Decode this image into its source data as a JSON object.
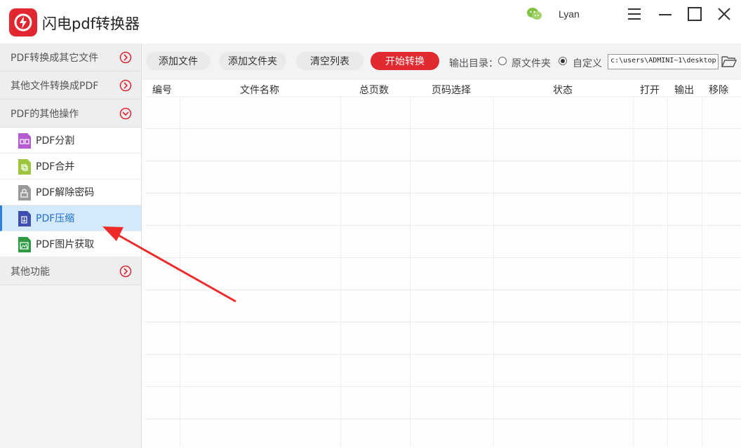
{
  "app": {
    "title": "闪电pdf转换器",
    "user_name": "Lyan",
    "accent_color": "#e0272f",
    "icons": [
      "logo-icon",
      "wechat-icon",
      "menu-icon",
      "minimize-icon",
      "maximize-icon",
      "close-icon"
    ]
  },
  "sidebar": {
    "categories": [
      {
        "label": "PDF转换成其它文件",
        "state": "collapsed"
      },
      {
        "label": "其他文件转换成PDF",
        "state": "collapsed"
      },
      {
        "label": "PDF的其他操作",
        "state": "expanded"
      },
      {
        "label": "其他功能",
        "state": "collapsed"
      }
    ],
    "items": [
      {
        "label": "PDF分割",
        "icon": "split-file-icon",
        "color": "#b45bd0"
      },
      {
        "label": "PDF合并",
        "icon": "merge-file-icon",
        "color": "#9dc53d"
      },
      {
        "label": "PDF解除密码",
        "icon": "unlock-file-icon",
        "color": "#9a9a9a"
      },
      {
        "label": "PDF压缩",
        "icon": "compress-file-icon",
        "color": "#3f4fb0",
        "active": true
      },
      {
        "label": "PDF图片获取",
        "icon": "image-file-icon",
        "color": "#2e9b44"
      }
    ]
  },
  "toolbar": {
    "add_file": "添加文件",
    "add_folder": "添加文件夹",
    "clear_list": "清空列表",
    "start": "开始转换",
    "output_label": "输出目录：",
    "option_original": "原文件夹",
    "option_custom": "自定义",
    "selected_option": "custom",
    "path_value": "c:\\users\\ADMINI~1\\desktop"
  },
  "table": {
    "columns": [
      "编号",
      "文件名称",
      "总页数",
      "页码选择",
      "状态",
      "打开",
      "输出",
      "移除"
    ],
    "rows": []
  }
}
